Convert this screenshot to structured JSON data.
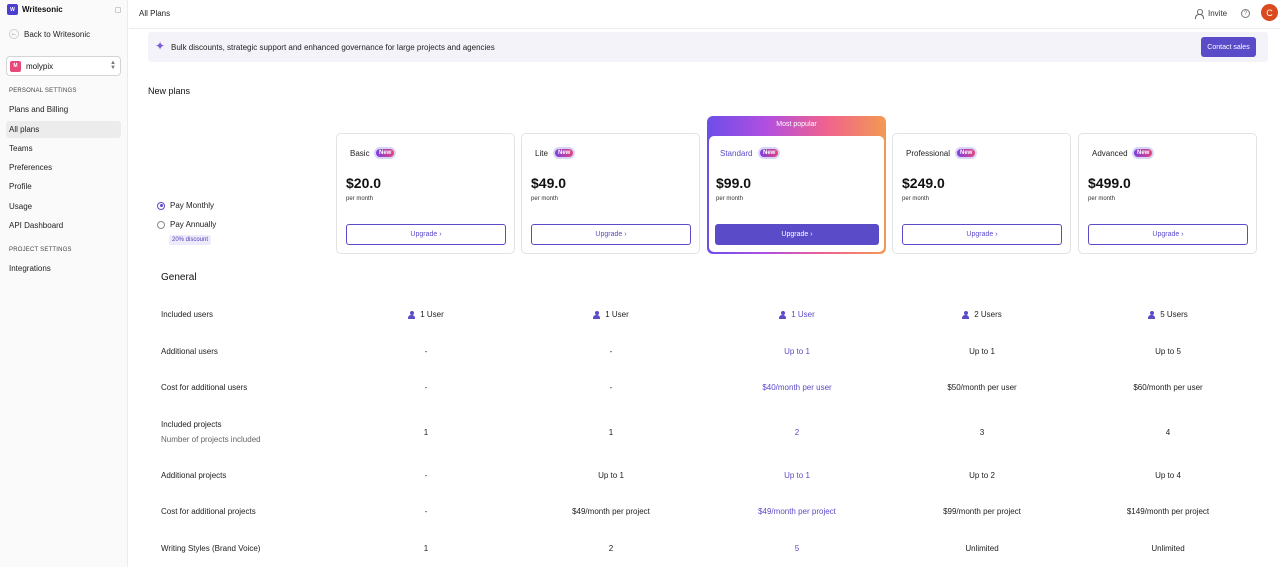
{
  "app": {
    "logo_mark": "W",
    "name": "Writesonic"
  },
  "sidebar": {
    "back_label": "Back to Writesonic",
    "workspace": {
      "initials": "M",
      "name": "molypix"
    },
    "personal_section": "PERSONAL SETTINGS",
    "personal_items": [
      "Plans and Billing",
      "All plans",
      "Teams",
      "Preferences",
      "Profile",
      "Usage",
      "API Dashboard"
    ],
    "project_section": "PROJECT SETTINGS",
    "project_items": [
      "Integrations"
    ]
  },
  "header": {
    "title": "All Plans",
    "invite_label": "Invite",
    "help_glyph": "?",
    "avatar_initial": "C"
  },
  "banner": {
    "text": "Bulk discounts, strategic support and enhanced governance for large projects and agencies",
    "contact_label": "Contact sales"
  },
  "section_title": "New plans",
  "billing": {
    "monthly_label": "Pay Monthly",
    "annual_label": "Pay Annually",
    "discount_label": "20% discount"
  },
  "new_badge": "New",
  "per_month": "per month",
  "upgrade_label": "Upgrade",
  "featured_label": "Most popular",
  "plans": [
    {
      "name": "Basic",
      "price": "$20.0"
    },
    {
      "name": "Lite",
      "price": "$49.0"
    },
    {
      "name": "Standard",
      "price": "$99.0"
    },
    {
      "name": "Professional",
      "price": "$249.0"
    },
    {
      "name": "Advanced",
      "price": "$499.0"
    }
  ],
  "general": {
    "title": "General",
    "rows": [
      {
        "label": "Included users",
        "values": [
          "1 User",
          "1 User",
          "1 User",
          "2 Users",
          "5 Users"
        ]
      },
      {
        "label": "Additional users",
        "values": [
          "-",
          "-",
          "Up to 1",
          "Up to 1",
          "Up to 5"
        ]
      },
      {
        "label": "Cost for additional users",
        "values": [
          "-",
          "-",
          "$40/month per user",
          "$50/month per user",
          "$60/month per user"
        ]
      },
      {
        "label": "Included projects",
        "sublabel": "Number of projects included",
        "values": [
          "1",
          "1",
          "2",
          "3",
          "4"
        ]
      },
      {
        "label": "Additional projects",
        "values": [
          "-",
          "Up to 1",
          "Up to 1",
          "Up to 2",
          "Up to 4"
        ]
      },
      {
        "label": "Cost for additional projects",
        "values": [
          "-",
          "$49/month per project",
          "$49/month per project",
          "$99/month per project",
          "$149/month per project"
        ]
      },
      {
        "label": "Writing Styles (Brand Voice)",
        "values": [
          "1",
          "2",
          "5",
          "Unlimited",
          "Unlimited"
        ]
      }
    ]
  },
  "colors": {
    "accent": "#5a4bc9",
    "avatar": "#d94a1e"
  }
}
